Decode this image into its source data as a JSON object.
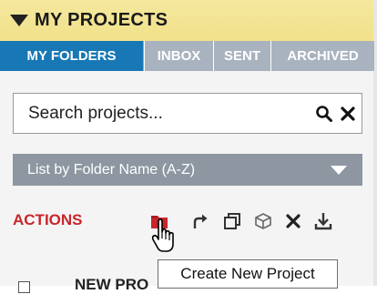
{
  "header": {
    "title": "MY PROJECTS"
  },
  "tabs": [
    {
      "label": "MY FOLDERS",
      "active": true
    },
    {
      "label": "INBOX"
    },
    {
      "label": "SENT"
    },
    {
      "label": "ARCHIVED"
    }
  ],
  "search": {
    "placeholder": "Search projects..."
  },
  "sort": {
    "selected": "List by Folder Name (A-Z)"
  },
  "actions": {
    "label": "ACTIONS",
    "buttons": [
      {
        "icon": "new-project-icon",
        "color": "#c8262b"
      },
      {
        "icon": "share-icon"
      },
      {
        "icon": "duplicate-icon"
      },
      {
        "icon": "cube-icon"
      },
      {
        "icon": "delete-icon"
      },
      {
        "icon": "download-icon"
      }
    ]
  },
  "tooltip": {
    "text": "Create New Project"
  },
  "list": {
    "first_item_label": "NEW PRO"
  },
  "colors": {
    "header_bg": "#f1e18a",
    "active_tab": "#1778b5",
    "inactive_tab": "#a9b3bf",
    "sort_bg": "#8d96a1",
    "actions_red": "#c8262b"
  }
}
